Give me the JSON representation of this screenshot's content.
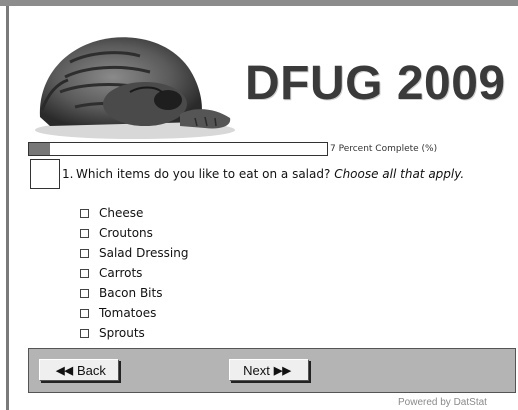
{
  "banner": {
    "title": "DFUG 2009"
  },
  "progress": {
    "percent": 7,
    "label": "7 Percent Complete (%)"
  },
  "question": {
    "number": "1.",
    "text": "Which items do you like to eat on a salad?",
    "instruction": "Choose all that apply.",
    "options": [
      {
        "label": "Cheese",
        "checked": false
      },
      {
        "label": "Croutons",
        "checked": false
      },
      {
        "label": "Salad Dressing",
        "checked": false
      },
      {
        "label": "Carrots",
        "checked": false
      },
      {
        "label": "Bacon Bits",
        "checked": false
      },
      {
        "label": "Tomatoes",
        "checked": false
      },
      {
        "label": "Sprouts",
        "checked": false
      }
    ]
  },
  "nav": {
    "back_label": "Back",
    "next_label": "Next"
  },
  "footer": {
    "powered": "Powered by DatStat"
  }
}
